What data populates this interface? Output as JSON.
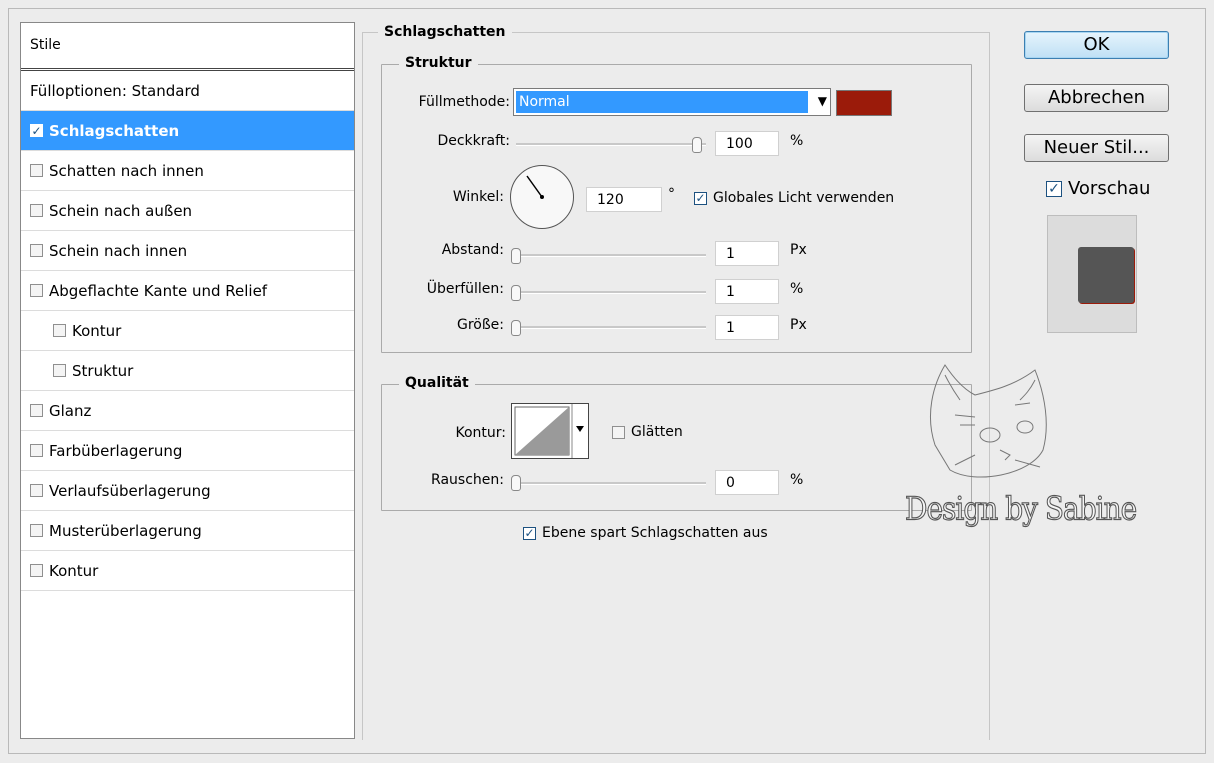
{
  "style_list": {
    "header": "Stile",
    "items": [
      {
        "label": "Fülloptionen: Standard",
        "checkbox": false,
        "checked": false,
        "selected": false,
        "indent": false
      },
      {
        "label": "Schlagschatten",
        "checkbox": true,
        "checked": true,
        "selected": true,
        "indent": false
      },
      {
        "label": "Schatten nach innen",
        "checkbox": true,
        "checked": false,
        "selected": false,
        "indent": false
      },
      {
        "label": "Schein nach außen",
        "checkbox": true,
        "checked": false,
        "selected": false,
        "indent": false
      },
      {
        "label": "Schein nach innen",
        "checkbox": true,
        "checked": false,
        "selected": false,
        "indent": false
      },
      {
        "label": "Abgeflachte Kante und Relief",
        "checkbox": true,
        "checked": false,
        "selected": false,
        "indent": false
      },
      {
        "label": "Kontur",
        "checkbox": true,
        "checked": false,
        "selected": false,
        "indent": true
      },
      {
        "label": "Struktur",
        "checkbox": true,
        "checked": false,
        "selected": false,
        "indent": true
      },
      {
        "label": "Glanz",
        "checkbox": true,
        "checked": false,
        "selected": false,
        "indent": false
      },
      {
        "label": "Farbüberlagerung",
        "checkbox": true,
        "checked": false,
        "selected": false,
        "indent": false
      },
      {
        "label": "Verlaufsüberlagerung",
        "checkbox": true,
        "checked": false,
        "selected": false,
        "indent": false
      },
      {
        "label": "Musterüberlagerung",
        "checkbox": true,
        "checked": false,
        "selected": false,
        "indent": false
      },
      {
        "label": "Kontur",
        "checkbox": true,
        "checked": false,
        "selected": false,
        "indent": false
      }
    ]
  },
  "panel": {
    "title": "Schlagschatten",
    "structure": {
      "title": "Struktur",
      "blend_mode_label": "Füllmethode:",
      "blend_mode_value": "Normal",
      "shadow_color": "#9b1b0a",
      "opacity_label": "Deckkraft:",
      "opacity_value": "100",
      "opacity_unit": "%",
      "angle_label": "Winkel:",
      "angle_value": "120",
      "angle_unit": "°",
      "global_light_label": "Globales Licht verwenden",
      "global_light_checked": true,
      "distance_label": "Abstand:",
      "distance_value": "1",
      "distance_unit": "Px",
      "spread_label": "Überfüllen:",
      "spread_value": "1",
      "spread_unit": "%",
      "size_label": "Größe:",
      "size_value": "1",
      "size_unit": "Px"
    },
    "quality": {
      "title": "Qualität",
      "contour_label": "Kontur:",
      "antialias_label": "Glätten",
      "antialias_checked": false,
      "noise_label": "Rauschen:",
      "noise_value": "0",
      "noise_unit": "%"
    },
    "knockout_label": "Ebene spart Schlagschatten aus",
    "knockout_checked": true
  },
  "buttons": {
    "ok": "OK",
    "cancel": "Abbrechen",
    "new_style": "Neuer Stil..."
  },
  "preview": {
    "label": "Vorschau",
    "checked": true
  },
  "watermark": "Design by Sabine"
}
